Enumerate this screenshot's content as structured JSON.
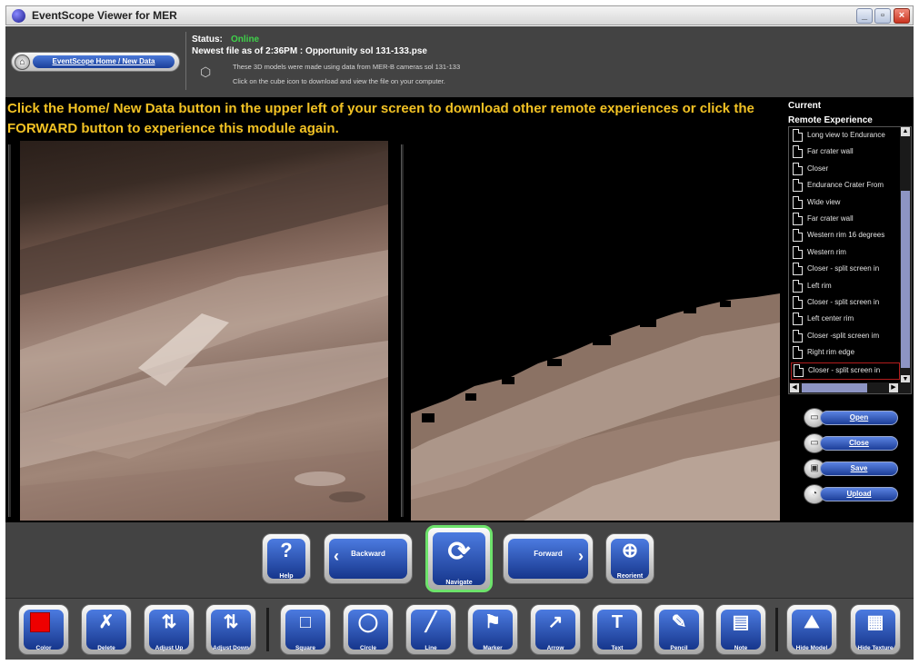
{
  "window": {
    "title": "EventScope Viewer for MER",
    "minimize": "_",
    "maximize": "▫",
    "close": "×"
  },
  "header": {
    "home_button": "EventScope Home / New Data",
    "status_label": "Status:",
    "status_value": "Online",
    "newest_file": "Newest file as of 2:36PM : Opportunity sol 131-133.pse",
    "info_line1": "These 3D models were made  using data from MER-B cameras sol 131-133",
    "info_line2": "Click on the cube icon to download and view the file on your computer."
  },
  "instruction": "Click the Home/ New Data button in the upper left of your screen to download other remote experiences or click the FORWARD button to experience this module again.",
  "experience_panel": {
    "title_line1": "Current",
    "title_line2": "Remote Experience",
    "items": [
      "Long view to Endurance",
      "Far crater wall",
      "Closer",
      "Endurance Crater From",
      "Wide view",
      "Far crater wall",
      "Western rim 16 degrees",
      "Western rim",
      "Closer - split screen in",
      "Left rim",
      "Closer - split screen in",
      "Left center rim",
      "Closer -split screen im",
      "Right rim edge",
      "Closer - split screen in"
    ],
    "selected_index": 14,
    "buttons": [
      "Open",
      "Close",
      "Save",
      "Upload"
    ]
  },
  "nav": {
    "help": "Help",
    "help_glyph": "?",
    "backward": "Backward",
    "navigate": "Navigate",
    "forward": "Forward",
    "reorient": "Reorient"
  },
  "tools": [
    {
      "id": "color",
      "label": "Color",
      "glyph": ""
    },
    {
      "id": "delete",
      "label": "Delete",
      "glyph": "✗"
    },
    {
      "id": "adjust-up",
      "label": "Adjust Up",
      "glyph": "⇅"
    },
    {
      "id": "adjust-down",
      "label": "Adjust Down",
      "glyph": "⇅"
    },
    {
      "id": "square",
      "label": "Square",
      "glyph": "□"
    },
    {
      "id": "circle",
      "label": "Circle",
      "glyph": "◯"
    },
    {
      "id": "line",
      "label": "Line",
      "glyph": "╱"
    },
    {
      "id": "marker",
      "label": "Marker",
      "glyph": "⚑"
    },
    {
      "id": "arrow",
      "label": "Arrow",
      "glyph": "↗"
    },
    {
      "id": "text",
      "label": "Text",
      "glyph": "T"
    },
    {
      "id": "pencil",
      "label": "Pencil",
      "glyph": "✎"
    },
    {
      "id": "note",
      "label": "Note",
      "glyph": "▤"
    },
    {
      "id": "hide-model",
      "label": "Hide Model",
      "glyph": "⛰"
    },
    {
      "id": "hide-texture",
      "label": "Hide Texture",
      "glyph": "▦"
    }
  ],
  "colors": {
    "instruction": "#f2c224",
    "status_online": "#3fd24a",
    "button_face": "#2a55b8",
    "active_outline": "#6de26b"
  }
}
